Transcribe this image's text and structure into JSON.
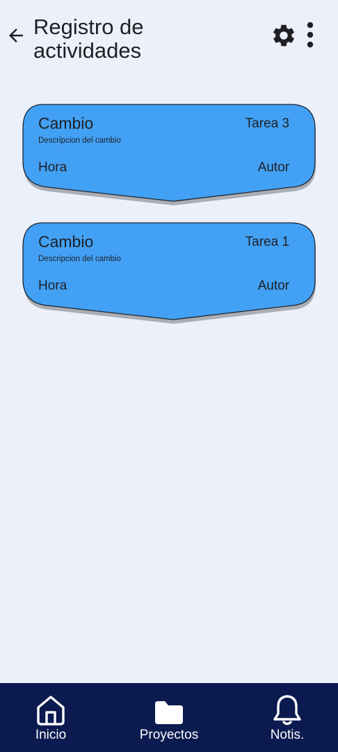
{
  "header": {
    "title": "Registro de actividades",
    "back_icon": "arrow-left-icon",
    "settings_icon": "gear-icon",
    "more_icon": "more-vertical-icon"
  },
  "activity_log": {
    "entries": [
      {
        "change": "Cambio",
        "task": "Tarea 3",
        "description": "Descripcion del cambio",
        "time": "Hora",
        "author": "Autor"
      },
      {
        "change": "Cambio",
        "task": "Tarea 1",
        "description": "Descripcion del cambio",
        "time": "Hora",
        "author": "Autor"
      }
    ]
  },
  "bottom_nav": {
    "items": [
      {
        "label": "Inicio",
        "icon": "home-icon"
      },
      {
        "label": "Proyectos",
        "icon": "folder-icon"
      },
      {
        "label": "Notis.",
        "icon": "bell-icon"
      }
    ]
  },
  "colors": {
    "background": "#ecf0fa",
    "card": "#42a1f4",
    "nav": "#0b1a4f",
    "text": "#1f1f24"
  }
}
